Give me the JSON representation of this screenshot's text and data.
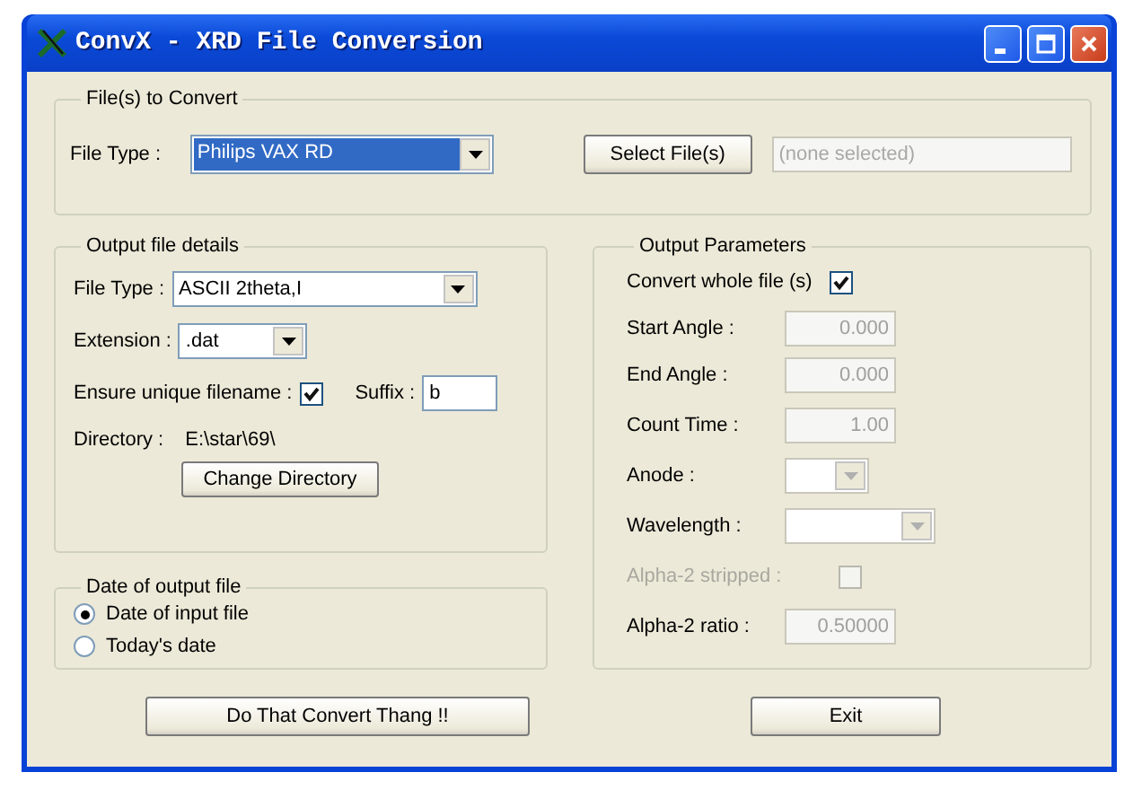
{
  "window": {
    "title": "ConvX - XRD File Conversion"
  },
  "files_to_convert": {
    "title": "File(s) to Convert",
    "file_type_label": "File Type :",
    "file_type": "Philips VAX RD",
    "select_button": "Select File(s)",
    "placeholder": "(none selected)"
  },
  "output_file_details": {
    "title": "Output file details",
    "file_type_label": "File Type :",
    "file_type": "ASCII 2theta,I",
    "extension_label": "Extension :",
    "extension": ".dat",
    "unique_label": "Ensure unique filename :",
    "unique_checked": true,
    "suffix_label": "Suffix :",
    "suffix": "b",
    "directory_label": "Directory :",
    "directory": "E:\\star\\69\\",
    "change_button": "Change Directory"
  },
  "date_of_output_file": {
    "title": "Date of output file",
    "options": [
      {
        "label": "Date of input file",
        "selected": true
      },
      {
        "label": "Today's date",
        "selected": false
      }
    ]
  },
  "output_parameters": {
    "title": "Output Parameters",
    "rows": [
      {
        "kind": "checkbox",
        "label": "Convert whole file (s)",
        "checked": true,
        "disabled": false
      },
      {
        "kind": "number",
        "label": "Start Angle :",
        "value": "0.000",
        "disabled": true
      },
      {
        "kind": "number",
        "label": "End Angle :",
        "value": "0.000",
        "disabled": true
      },
      {
        "kind": "number",
        "label": "Count  Time :",
        "value": "1.00",
        "disabled": true
      },
      {
        "kind": "dropdown",
        "label": "Anode :",
        "disabled": true
      },
      {
        "kind": "dropdown",
        "label": "Wavelength :",
        "disabled": true
      },
      {
        "kind": "checkbox",
        "label": "Alpha-2 stripped :",
        "checked": false,
        "disabled": true
      },
      {
        "kind": "number",
        "label": "Alpha-2 ratio :",
        "value": "0.50000",
        "disabled": true
      }
    ]
  },
  "buttons": [
    {
      "label": "Do That Convert Thang !!"
    },
    {
      "label": "Exit"
    }
  ]
}
